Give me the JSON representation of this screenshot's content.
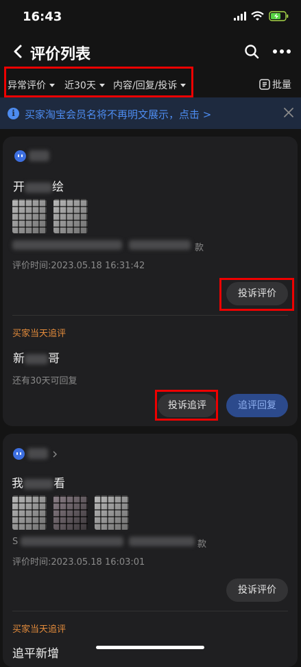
{
  "status_bar": {
    "time": "16:43"
  },
  "header": {
    "title": "评价列表"
  },
  "filters": {
    "type": "异常评价",
    "period": "近30天",
    "category": "内容/回复/投诉",
    "batch": "批量"
  },
  "notice": {
    "text": "买家淘宝会员名将不再明文展示，点击 >"
  },
  "cards": [
    {
      "comment_start": "开",
      "comment_end": "绘",
      "sku_end": "款",
      "time": "评价时间:2023.05.18 16:31:42",
      "complain_button": "投诉评价",
      "followup_tag": "买家当天追评",
      "followup_start": "新",
      "followup_end": "哥",
      "reply_window": "还有30天可回复",
      "complain_followup_button": "投诉追评",
      "reply_followup_button": "追评回复"
    },
    {
      "comment_start": "我",
      "comment_end": "看",
      "sku_start": "S",
      "sku_end": "款",
      "time": "评价时间:2023.05.18 16:03:01",
      "complain_button": "投诉评价",
      "followup_tag": "买家当天追评",
      "followup_text": "追平新增"
    }
  ]
}
